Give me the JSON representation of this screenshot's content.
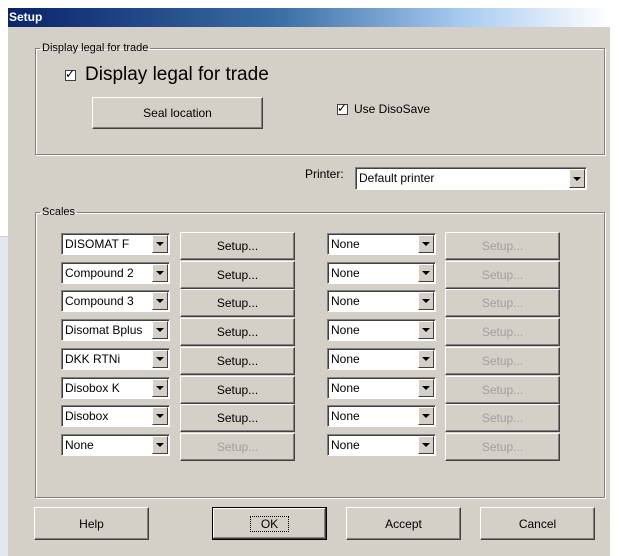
{
  "window": {
    "title": "Setup"
  },
  "legal_group": {
    "legend": "Display legal for trade",
    "display_checkbox": {
      "label": "Display legal for trade",
      "checked": true
    },
    "seal_button": "Seal location",
    "disosave_checkbox": {
      "label": "Use DisoSave",
      "checked": true
    }
  },
  "printer": {
    "label": "Printer:",
    "value": "Default printer"
  },
  "scales_group": {
    "legend": "Scales",
    "left": [
      {
        "scale": "DISOMAT F",
        "setup": "Setup...",
        "enabled": true
      },
      {
        "scale": "Compound 2",
        "setup": "Setup...",
        "enabled": true
      },
      {
        "scale": "Compound 3",
        "setup": "Setup...",
        "enabled": true
      },
      {
        "scale": "Disomat Bplus",
        "setup": "Setup...",
        "enabled": true
      },
      {
        "scale": "DKK RTNi",
        "setup": "Setup...",
        "enabled": true
      },
      {
        "scale": "Disobox K",
        "setup": "Setup...",
        "enabled": true
      },
      {
        "scale": "Disobox",
        "setup": "Setup...",
        "enabled": true
      },
      {
        "scale": "None",
        "setup": "Setup...",
        "enabled": false
      }
    ],
    "right": [
      {
        "scale": "None",
        "setup": "Setup...",
        "enabled": false
      },
      {
        "scale": "None",
        "setup": "Setup...",
        "enabled": false
      },
      {
        "scale": "None",
        "setup": "Setup...",
        "enabled": false
      },
      {
        "scale": "None",
        "setup": "Setup...",
        "enabled": false
      },
      {
        "scale": "None",
        "setup": "Setup...",
        "enabled": false
      },
      {
        "scale": "None",
        "setup": "Setup...",
        "enabled": false
      },
      {
        "scale": "None",
        "setup": "Setup...",
        "enabled": false
      },
      {
        "scale": "None",
        "setup": "Setup...",
        "enabled": false
      }
    ]
  },
  "footer": {
    "help": "Help",
    "ok": "OK",
    "accept": "Accept",
    "cancel": "Cancel"
  }
}
